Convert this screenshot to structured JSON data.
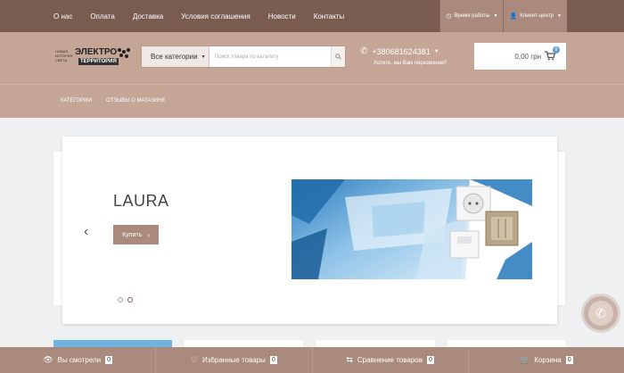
{
  "topnav": {
    "links": [
      "О нас",
      "Оплата",
      "Доставка",
      "Условия соглашения",
      "Новости",
      "Контакты"
    ],
    "hours_label": "Время работы",
    "client_label": "Клиент-центр"
  },
  "header": {
    "logo_small": "НОВАЯ ИСТОРИЯ СВЕТА",
    "logo_big": "ЭЛЕКТРО",
    "logo_big2": "ТЕРРИТОРИЯ",
    "category_label": "Все категории",
    "search_placeholder": "Поиск товара по каталогу",
    "phone": "+380681624381",
    "callback": "Хотите, мы Вам перезвоним?",
    "cart_sum": "0,00 грн",
    "cart_count": "0"
  },
  "subnav": {
    "catalog": "КАТЕГОРИИ",
    "reviews": "ОТЗЫВЫ О МАГАЗИНЕ"
  },
  "slider": {
    "title": "LAURA",
    "buy_label": "Купить"
  },
  "bottombar": {
    "viewed": {
      "label": "Вы смотрели",
      "count": "0"
    },
    "favorites": {
      "label": "Избранные товары",
      "count": "0"
    },
    "compare": {
      "label": "Сравнение товаров",
      "count": "0"
    },
    "cart": {
      "label": "Корзина",
      "count": "0"
    }
  },
  "colors": {
    "topbar": "#7a5b4f",
    "header": "#c4a596",
    "accent": "#a98a7c"
  },
  "icons": [
    "clock-icon",
    "user-icon",
    "search-icon",
    "phone-icon",
    "cart-icon",
    "chevron-left-icon",
    "eye-icon",
    "heart-icon",
    "compare-icon",
    "basket-icon",
    "call-icon"
  ]
}
